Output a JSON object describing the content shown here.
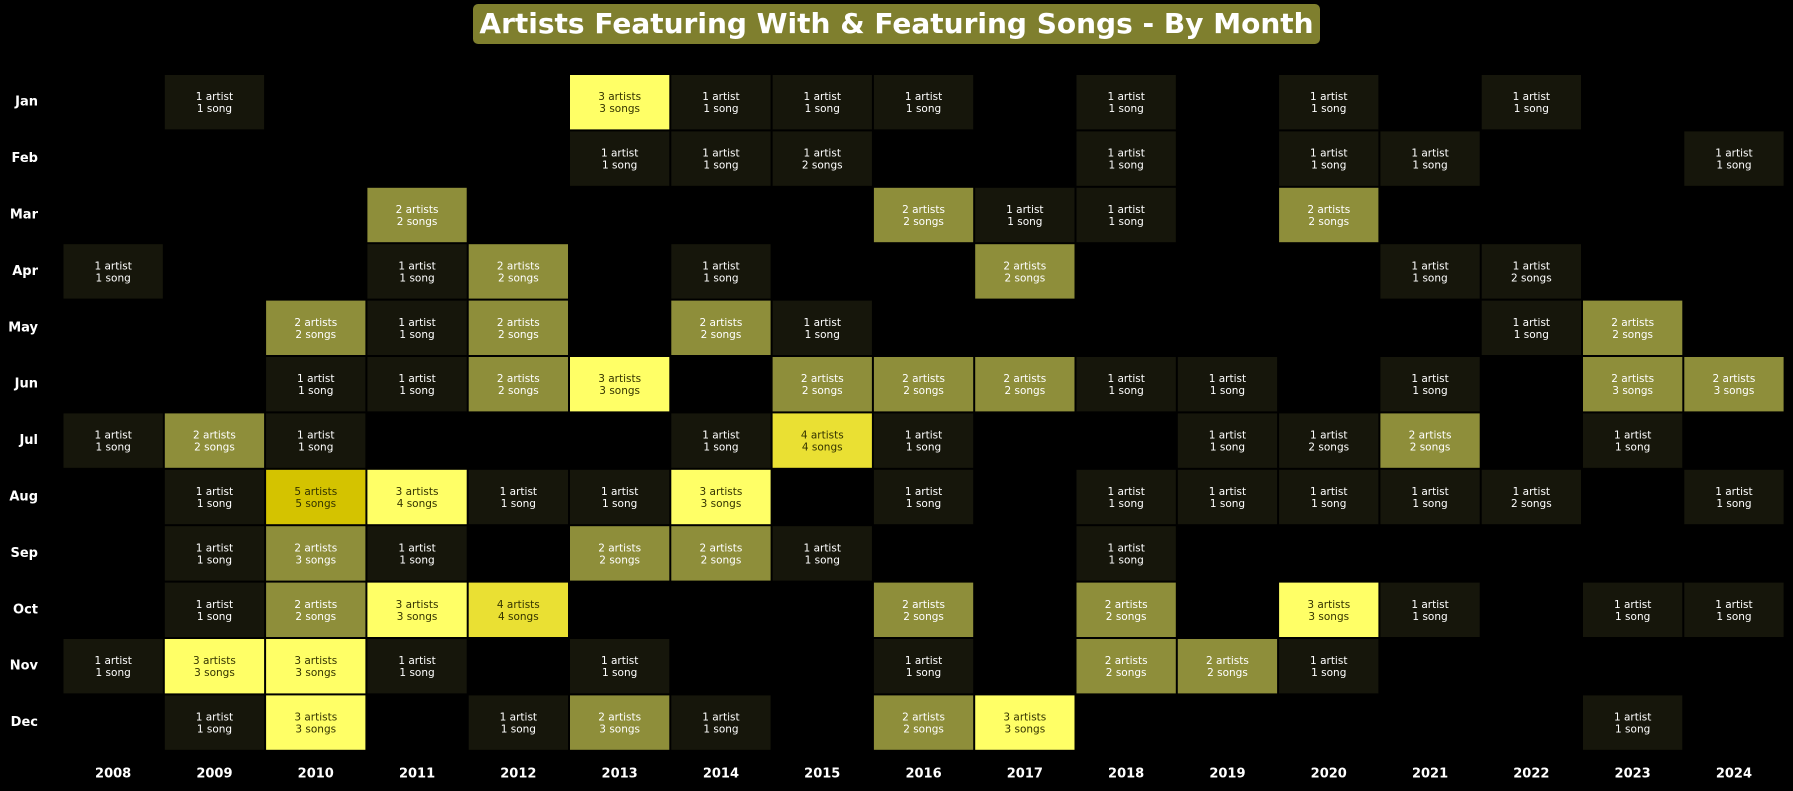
{
  "chart_data": {
    "type": "heatmap",
    "title": "Artists Featuring With & Featuring Songs - By Month",
    "xlabel": "",
    "ylabel": "",
    "x_categories": [
      "2008",
      "2009",
      "2010",
      "2011",
      "2012",
      "2013",
      "2014",
      "2015",
      "2016",
      "2017",
      "2018",
      "2019",
      "2020",
      "2021",
      "2022",
      "2023",
      "2024"
    ],
    "y_categories": [
      "Jan",
      "Feb",
      "Mar",
      "Apr",
      "May",
      "Jun",
      "Jul",
      "Aug",
      "Sep",
      "Oct",
      "Nov",
      "Dec"
    ],
    "cells": [
      {
        "year": "2009",
        "month": "Jan",
        "artists": 1,
        "songs": 1,
        "label": "1 artist\n1 song"
      },
      {
        "year": "2013",
        "month": "Jan",
        "artists": 3,
        "songs": 3,
        "label": "3 artists\n3 songs"
      },
      {
        "year": "2014",
        "month": "Jan",
        "artists": 1,
        "songs": 1,
        "label": "1 artist\n1 song"
      },
      {
        "year": "2015",
        "month": "Jan",
        "artists": 1,
        "songs": 1,
        "label": "1 artist\n1 song"
      },
      {
        "year": "2016",
        "month": "Jan",
        "artists": 1,
        "songs": 1,
        "label": "1 artist\n1 song"
      },
      {
        "year": "2018",
        "month": "Jan",
        "artists": 1,
        "songs": 1,
        "label": "1 artist\n1 song"
      },
      {
        "year": "2020",
        "month": "Jan",
        "artists": 1,
        "songs": 1,
        "label": "1 artist\n1 song"
      },
      {
        "year": "2022",
        "month": "Jan",
        "artists": 1,
        "songs": 1,
        "label": "1 artist\n1 song"
      },
      {
        "year": "2013",
        "month": "Feb",
        "artists": 1,
        "songs": 1,
        "label": "1 artist\n1 song"
      },
      {
        "year": "2014",
        "month": "Feb",
        "artists": 1,
        "songs": 1,
        "label": "1 artist\n1 song"
      },
      {
        "year": "2015",
        "month": "Feb",
        "artists": 1,
        "songs": 2,
        "label": "1 artist\n2 songs"
      },
      {
        "year": "2018",
        "month": "Feb",
        "artists": 1,
        "songs": 1,
        "label": "1 artist\n1 song"
      },
      {
        "year": "2020",
        "month": "Feb",
        "artists": 1,
        "songs": 1,
        "label": "1 artist\n1 song"
      },
      {
        "year": "2021",
        "month": "Feb",
        "artists": 1,
        "songs": 1,
        "label": "1 artist\n1 song"
      },
      {
        "year": "2024",
        "month": "Feb",
        "artists": 1,
        "songs": 1,
        "label": "1 artist\n1 song"
      },
      {
        "year": "2011",
        "month": "Mar",
        "artists": 2,
        "songs": 2,
        "label": "2 artists\n2 songs"
      },
      {
        "year": "2016",
        "month": "Mar",
        "artists": 2,
        "songs": 2,
        "label": "2 artists\n2 songs"
      },
      {
        "year": "2017",
        "month": "Mar",
        "artists": 1,
        "songs": 1,
        "label": "1 artist\n1 song"
      },
      {
        "year": "2018",
        "month": "Mar",
        "artists": 1,
        "songs": 1,
        "label": "1 artist\n1 song"
      },
      {
        "year": "2020",
        "month": "Mar",
        "artists": 2,
        "songs": 2,
        "label": "2 artists\n2 songs"
      },
      {
        "year": "2008",
        "month": "Apr",
        "artists": 1,
        "songs": 1,
        "label": "1 artist\n1 song"
      },
      {
        "year": "2011",
        "month": "Apr",
        "artists": 1,
        "songs": 1,
        "label": "1 artist\n1 song"
      },
      {
        "year": "2012",
        "month": "Apr",
        "artists": 2,
        "songs": 2,
        "label": "2 artists\n2 songs"
      },
      {
        "year": "2014",
        "month": "Apr",
        "artists": 1,
        "songs": 1,
        "label": "1 artist\n1 song"
      },
      {
        "year": "2017",
        "month": "Apr",
        "artists": 2,
        "songs": 2,
        "label": "2 artists\n2 songs"
      },
      {
        "year": "2021",
        "month": "Apr",
        "artists": 1,
        "songs": 1,
        "label": "1 artist\n1 song"
      },
      {
        "year": "2022",
        "month": "Apr",
        "artists": 1,
        "songs": 2,
        "label": "1 artist\n2 songs"
      },
      {
        "year": "2010",
        "month": "May",
        "artists": 2,
        "songs": 2,
        "label": "2 artists\n2 songs"
      },
      {
        "year": "2011",
        "month": "May",
        "artists": 1,
        "songs": 1,
        "label": "1 artist\n1 song"
      },
      {
        "year": "2012",
        "month": "May",
        "artists": 2,
        "songs": 2,
        "label": "2 artists\n2 songs"
      },
      {
        "year": "2014",
        "month": "May",
        "artists": 2,
        "songs": 2,
        "label": "2 artists\n2 songs"
      },
      {
        "year": "2015",
        "month": "May",
        "artists": 1,
        "songs": 1,
        "label": "1 artist\n1 song"
      },
      {
        "year": "2022",
        "month": "May",
        "artists": 1,
        "songs": 1,
        "label": "1 artist\n1 song"
      },
      {
        "year": "2023",
        "month": "May",
        "artists": 2,
        "songs": 2,
        "label": "2 artists\n2 songs"
      },
      {
        "year": "2010",
        "month": "Jun",
        "artists": 1,
        "songs": 1,
        "label": "1 artist\n1 song"
      },
      {
        "year": "2011",
        "month": "Jun",
        "artists": 1,
        "songs": 1,
        "label": "1 artist\n1 song"
      },
      {
        "year": "2012",
        "month": "Jun",
        "artists": 2,
        "songs": 2,
        "label": "2 artists\n2 songs"
      },
      {
        "year": "2013",
        "month": "Jun",
        "artists": 3,
        "songs": 3,
        "label": "3 artists\n3 songs"
      },
      {
        "year": "2015",
        "month": "Jun",
        "artists": 2,
        "songs": 2,
        "label": "2 artists\n2 songs"
      },
      {
        "year": "2016",
        "month": "Jun",
        "artists": 2,
        "songs": 2,
        "label": "2 artists\n2 songs"
      },
      {
        "year": "2017",
        "month": "Jun",
        "artists": 2,
        "songs": 2,
        "label": "2 artists\n2 songs"
      },
      {
        "year": "2018",
        "month": "Jun",
        "artists": 1,
        "songs": 1,
        "label": "1 artist\n1 song"
      },
      {
        "year": "2019",
        "month": "Jun",
        "artists": 1,
        "songs": 1,
        "label": "1 artist\n1 song"
      },
      {
        "year": "2021",
        "month": "Jun",
        "artists": 1,
        "songs": 1,
        "label": "1 artist\n1 song"
      },
      {
        "year": "2023",
        "month": "Jun",
        "artists": 2,
        "songs": 3,
        "label": "2 artists\n3 songs"
      },
      {
        "year": "2024",
        "month": "Jun",
        "artists": 2,
        "songs": 3,
        "label": "2 artists\n3 songs"
      },
      {
        "year": "2008",
        "month": "Jul",
        "artists": 1,
        "songs": 1,
        "label": "1 artist\n1 song"
      },
      {
        "year": "2009",
        "month": "Jul",
        "artists": 2,
        "songs": 2,
        "label": "2 artists\n2 songs"
      },
      {
        "year": "2010",
        "month": "Jul",
        "artists": 1,
        "songs": 1,
        "label": "1 artist\n1 song"
      },
      {
        "year": "2014",
        "month": "Jul",
        "artists": 1,
        "songs": 1,
        "label": "1 artist\n1 song"
      },
      {
        "year": "2015",
        "month": "Jul",
        "artists": 4,
        "songs": 4,
        "label": "4 artists\n4 songs"
      },
      {
        "year": "2016",
        "month": "Jul",
        "artists": 1,
        "songs": 1,
        "label": "1 artist\n1 song"
      },
      {
        "year": "2019",
        "month": "Jul",
        "artists": 1,
        "songs": 1,
        "label": "1 artist\n1 song"
      },
      {
        "year": "2020",
        "month": "Jul",
        "artists": 1,
        "songs": 2,
        "label": "1 artist\n2 songs"
      },
      {
        "year": "2021",
        "month": "Jul",
        "artists": 2,
        "songs": 2,
        "label": "2 artists\n2 songs"
      },
      {
        "year": "2023",
        "month": "Jul",
        "artists": 1,
        "songs": 1,
        "label": "1 artist\n1 song"
      },
      {
        "year": "2009",
        "month": "Aug",
        "artists": 1,
        "songs": 1,
        "label": "1 artist\n1 song"
      },
      {
        "year": "2010",
        "month": "Aug",
        "artists": 5,
        "songs": 5,
        "label": "5 artists\n5 songs"
      },
      {
        "year": "2011",
        "month": "Aug",
        "artists": 3,
        "songs": 4,
        "label": "3 artists\n4 songs"
      },
      {
        "year": "2012",
        "month": "Aug",
        "artists": 1,
        "songs": 1,
        "label": "1 artist\n1 song"
      },
      {
        "year": "2013",
        "month": "Aug",
        "artists": 1,
        "songs": 1,
        "label": "1 artist\n1 song"
      },
      {
        "year": "2014",
        "month": "Aug",
        "artists": 3,
        "songs": 3,
        "label": "3 artists\n3 songs"
      },
      {
        "year": "2016",
        "month": "Aug",
        "artists": 1,
        "songs": 1,
        "label": "1 artist\n1 song"
      },
      {
        "year": "2018",
        "month": "Aug",
        "artists": 1,
        "songs": 1,
        "label": "1 artist\n1 song"
      },
      {
        "year": "2019",
        "month": "Aug",
        "artists": 1,
        "songs": 1,
        "label": "1 artist\n1 song"
      },
      {
        "year": "2020",
        "month": "Aug",
        "artists": 1,
        "songs": 1,
        "label": "1 artist\n1 song"
      },
      {
        "year": "2021",
        "month": "Aug",
        "artists": 1,
        "songs": 1,
        "label": "1 artist\n1 song"
      },
      {
        "year": "2022",
        "month": "Aug",
        "artists": 1,
        "songs": 2,
        "label": "1 artist\n2 songs"
      },
      {
        "year": "2024",
        "month": "Aug",
        "artists": 1,
        "songs": 1,
        "label": "1 artist\n1 song"
      },
      {
        "year": "2009",
        "month": "Sep",
        "artists": 1,
        "songs": 1,
        "label": "1 artist\n1 song"
      },
      {
        "year": "2010",
        "month": "Sep",
        "artists": 2,
        "songs": 3,
        "label": "2 artists\n3 songs"
      },
      {
        "year": "2011",
        "month": "Sep",
        "artists": 1,
        "songs": 1,
        "label": "1 artist\n1 song"
      },
      {
        "year": "2013",
        "month": "Sep",
        "artists": 2,
        "songs": 2,
        "label": "2 artists\n2 songs"
      },
      {
        "year": "2014",
        "month": "Sep",
        "artists": 2,
        "songs": 2,
        "label": "2 artists\n2 songs"
      },
      {
        "year": "2015",
        "month": "Sep",
        "artists": 1,
        "songs": 1,
        "label": "1 artist\n1 song"
      },
      {
        "year": "2018",
        "month": "Sep",
        "artists": 1,
        "songs": 1,
        "label": "1 artist\n1 song"
      },
      {
        "year": "2009",
        "month": "Oct",
        "artists": 1,
        "songs": 1,
        "label": "1 artist\n1 song"
      },
      {
        "year": "2010",
        "month": "Oct",
        "artists": 2,
        "songs": 2,
        "label": "2 artists\n2 songs"
      },
      {
        "year": "2011",
        "month": "Oct",
        "artists": 3,
        "songs": 3,
        "label": "3 artists\n3 songs"
      },
      {
        "year": "2012",
        "month": "Oct",
        "artists": 4,
        "songs": 4,
        "label": "4 artists\n4 songs"
      },
      {
        "year": "2016",
        "month": "Oct",
        "artists": 2,
        "songs": 2,
        "label": "2 artists\n2 songs"
      },
      {
        "year": "2018",
        "month": "Oct",
        "artists": 2,
        "songs": 2,
        "label": "2 artists\n2 songs"
      },
      {
        "year": "2020",
        "month": "Oct",
        "artists": 3,
        "songs": 3,
        "label": "3 artists\n3 songs"
      },
      {
        "year": "2021",
        "month": "Oct",
        "artists": 1,
        "songs": 1,
        "label": "1 artist\n1 song"
      },
      {
        "year": "2023",
        "month": "Oct",
        "artists": 1,
        "songs": 1,
        "label": "1 artist\n1 song"
      },
      {
        "year": "2024",
        "month": "Oct",
        "artists": 1,
        "songs": 1,
        "label": "1 artist\n1 song"
      },
      {
        "year": "2008",
        "month": "Nov",
        "artists": 1,
        "songs": 1,
        "label": "1 artist\n1 song"
      },
      {
        "year": "2009",
        "month": "Nov",
        "artists": 3,
        "songs": 3,
        "label": "3 artists\n3 songs"
      },
      {
        "year": "2010",
        "month": "Nov",
        "artists": 3,
        "songs": 3,
        "label": "3 artists\n3 songs"
      },
      {
        "year": "2011",
        "month": "Nov",
        "artists": 1,
        "songs": 1,
        "label": "1 artist\n1 song"
      },
      {
        "year": "2013",
        "month": "Nov",
        "artists": 1,
        "songs": 1,
        "label": "1 artist\n1 song"
      },
      {
        "year": "2016",
        "month": "Nov",
        "artists": 1,
        "songs": 1,
        "label": "1 artist\n1 song"
      },
      {
        "year": "2018",
        "month": "Nov",
        "artists": 2,
        "songs": 2,
        "label": "2 artists\n2 songs"
      },
      {
        "year": "2019",
        "month": "Nov",
        "artists": 2,
        "songs": 2,
        "label": "2 artists\n2 songs"
      },
      {
        "year": "2020",
        "month": "Nov",
        "artists": 1,
        "songs": 1,
        "label": "1 artist\n1 song"
      },
      {
        "year": "2009",
        "month": "Dec",
        "artists": 1,
        "songs": 1,
        "label": "1 artist\n1 song"
      },
      {
        "year": "2010",
        "month": "Dec",
        "artists": 3,
        "songs": 3,
        "label": "3 artists\n3 songs"
      },
      {
        "year": "2012",
        "month": "Dec",
        "artists": 1,
        "songs": 1,
        "label": "1 artist\n1 song"
      },
      {
        "year": "2013",
        "month": "Dec",
        "artists": 2,
        "songs": 3,
        "label": "2 artists\n3 songs"
      },
      {
        "year": "2014",
        "month": "Dec",
        "artists": 1,
        "songs": 1,
        "label": "1 artist\n1 song"
      },
      {
        "year": "2016",
        "month": "Dec",
        "artists": 2,
        "songs": 2,
        "label": "2 artists\n2 songs"
      },
      {
        "year": "2017",
        "month": "Dec",
        "artists": 3,
        "songs": 3,
        "label": "3 artists\n3 songs"
      },
      {
        "year": "2023",
        "month": "Dec",
        "artists": 1,
        "songs": 1,
        "label": "1 artist\n1 song"
      }
    ]
  },
  "colors": {
    "background": "#000000",
    "title_box": "#7f7f2e",
    "title_text": "#ffffff",
    "axis_text": "#ffffff",
    "level_1": "#16160b",
    "level_2": "#8e8e3a",
    "level_3": "#ffff66",
    "level_4": "#eae033",
    "level_5": "#d4c300",
    "label_light": "#ffffff",
    "label_dark": "#333300"
  }
}
